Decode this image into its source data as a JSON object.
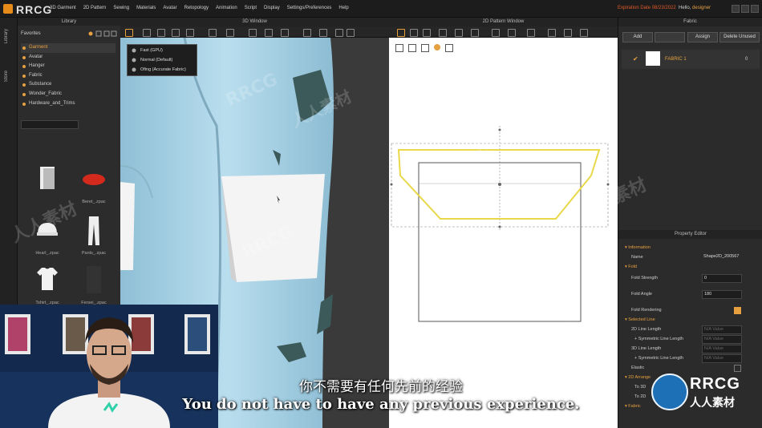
{
  "app": {
    "brand": "RRCG",
    "menu": [
      "3D Garment",
      "2D Pattern",
      "Sewing",
      "Materials",
      "Avatar",
      "Retopology",
      "Animation",
      "Script",
      "Display",
      "Settings/Preferences",
      "Help"
    ],
    "expiry": "Expiration Date 08/23/2022",
    "hello_prefix": "Hello,",
    "username": "designer"
  },
  "sidetabs": [
    "Library",
    "Store"
  ],
  "library": {
    "title": "Library",
    "favorites_label": "Favorites",
    "favorites": [
      "Garment",
      "Avatar",
      "Hanger",
      "Fabric",
      "Substance",
      "Wonder_Fabric",
      "Hardware_and_Trims"
    ],
    "selected_index": 0,
    "items": [
      {
        "label": "",
        "icon": "folder-icon"
      },
      {
        "label": "Beret_.zpac",
        "icon": "beret-icon"
      },
      {
        "label": "Hearl_.zpac",
        "icon": "hat-icon"
      },
      {
        "label": "Pants_.zpac",
        "icon": "pants-icon"
      },
      {
        "label": "Tshirt_.zpac",
        "icon": "tshirt-icon"
      },
      {
        "label": "Fersei_.zpac",
        "icon": "dress-icon"
      }
    ]
  },
  "viewport3d": {
    "title": "3D Window",
    "dropdown": [
      "Fast (GPU)",
      "Normal (Default)",
      "Ofing (Accurate Fabric)"
    ]
  },
  "viewport2d": {
    "title": "2D Pattern Window"
  },
  "fabric": {
    "title": "Fabric",
    "buttons": {
      "add": "Add",
      "copy": "",
      "assign": "Assign",
      "delete": "Delete Unused"
    },
    "item_name": "FABRIC 1",
    "item_count": "0"
  },
  "property": {
    "title": "Property Editor",
    "information": "Information",
    "name_label": "Name",
    "name_value": "Shape2D_200567",
    "fold": "Fold",
    "fold_strength_label": "Fold Strength",
    "fold_strength_value": "0",
    "fold_angle_label": "Fold Angle",
    "fold_angle_value": "180",
    "fold_rendering_label": "Fold Rendering",
    "selected_line": "Selected Line",
    "line_length_2d": "2D Line Length",
    "sym_line_length": "+ Symmetric Line Length",
    "line_length_3d": "3D Line Length",
    "elastic": "Elastic",
    "multi_val": "N/A Value",
    "section_2d": "2D Arrange",
    "to_3d": "To 3D",
    "to_2d": "To 2D",
    "fabric_sec": "Fabric"
  },
  "subtitles": {
    "cn": "你不需要有任何先前的经验",
    "en": "You do not have to have any previous experience."
  },
  "watermark": {
    "rrcg": "RRCG",
    "cn": "人人素材"
  },
  "colors": {
    "accent": "#e6a040",
    "pants": "#a9d4e6",
    "expiry": "#e25a2a",
    "pattern_line": "#e8d84a"
  }
}
